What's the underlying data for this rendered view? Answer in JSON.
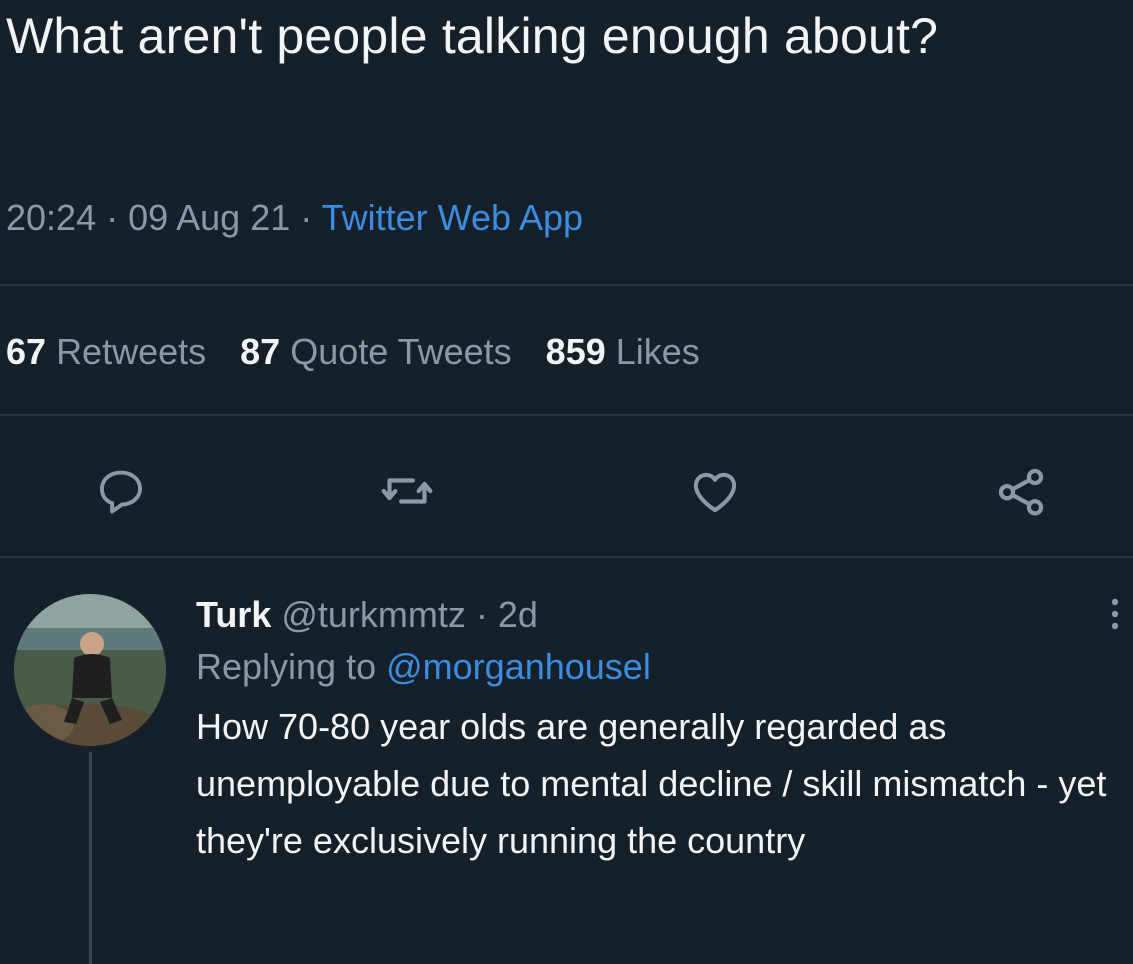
{
  "tweet": {
    "text": "What aren't people talking enough about?",
    "time": "20:24",
    "date": "09 Aug 21",
    "source": "Twitter Web App",
    "separator": " · "
  },
  "stats": {
    "retweets_count": "67",
    "retweets_label": "Retweets",
    "quotes_count": "87",
    "quotes_label": "Quote Tweets",
    "likes_count": "859",
    "likes_label": "Likes"
  },
  "actions": [
    "reply-icon",
    "retweet-icon",
    "like-icon",
    "share-icon"
  ],
  "reply": {
    "name": "Turk",
    "handle": "@turkmmtz",
    "age": "2d",
    "replying_prefix": "Replying to",
    "replying_to": "@morganhousel",
    "text": "How 70-80 year olds are generally regarded as unemployable due to mental decline / skill mismatch - yet they're exclusively running the country"
  },
  "colors": {
    "background": "#15202b",
    "link": "#3a8de0",
    "muted": "#8b98a5",
    "text": "#f2f4f6"
  }
}
